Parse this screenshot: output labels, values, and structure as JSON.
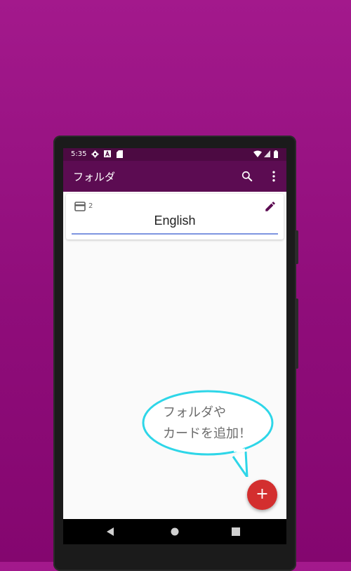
{
  "status_bar": {
    "time": "5:35"
  },
  "app_bar": {
    "title": "フォルダ"
  },
  "folder": {
    "name": "English",
    "card_count": "2"
  },
  "bubble": {
    "line1": "フォルダや",
    "line2": "カードを追加！"
  },
  "fab": {
    "label": "+"
  },
  "colors": {
    "appbar": "#5c0c52",
    "status_bar": "#4c0a42",
    "fab": "#d32f2f",
    "bubble_border": "#2ed6e8",
    "underline": "#7e95e0"
  },
  "icons": [
    "settings-icon",
    "a-icon",
    "sd-card-icon",
    "wifi-icon",
    "signal-icon",
    "battery-icon",
    "search-icon",
    "more-vert-icon",
    "cards-icon",
    "edit-icon",
    "back-icon",
    "home-icon",
    "recents-icon"
  ]
}
